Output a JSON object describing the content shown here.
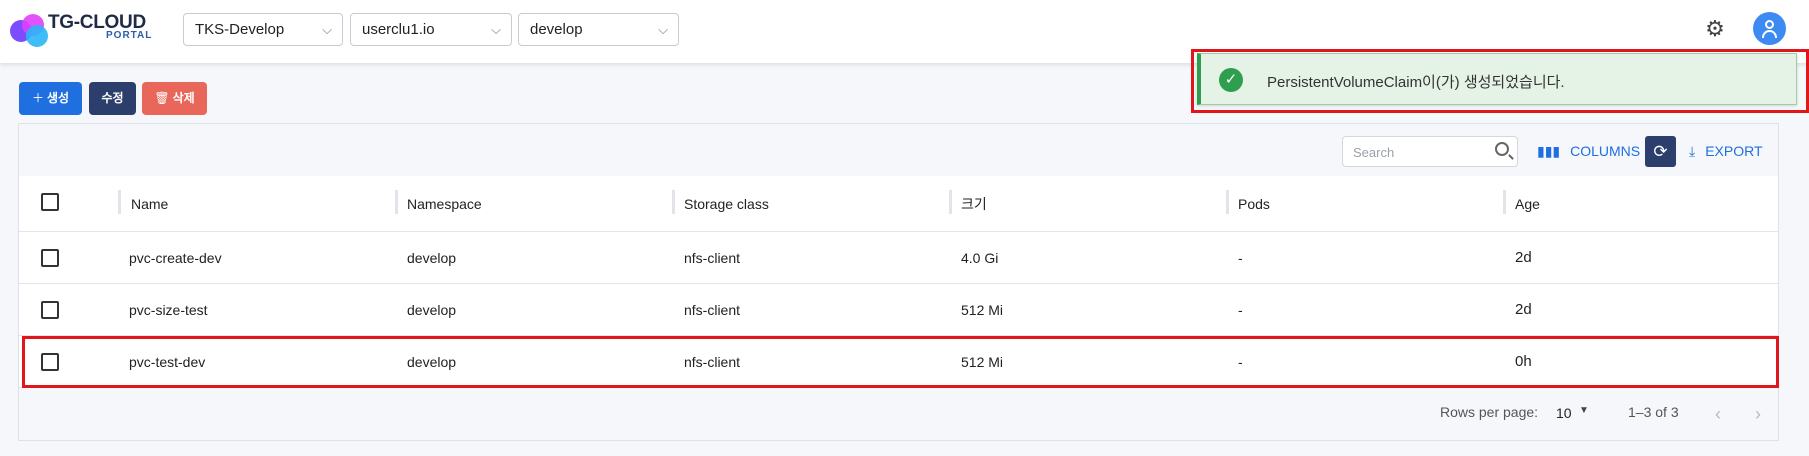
{
  "header": {
    "logo_title": "TG-CLOUD",
    "logo_subtitle": "PORTAL",
    "cluster": "TKS-Develop",
    "user_cluster": "userclu1.io",
    "namespace": "develop"
  },
  "toast": {
    "message": "PersistentVolumeClaim이(가) 생성되었습니다.",
    "color": "#2e9e4f"
  },
  "actions": {
    "create": "생성",
    "edit": "수정",
    "delete": "삭제"
  },
  "toolbar": {
    "search_placeholder": "Search",
    "columns": "COLUMNS",
    "export": "EXPORT"
  },
  "table": {
    "columns": [
      "Name",
      "Namespace",
      "Storage class",
      "크기",
      "Pods",
      "Age"
    ],
    "rows": [
      {
        "name": "pvc-create-dev",
        "namespace": "develop",
        "storage_class": "nfs-client",
        "size": "4.0 Gi",
        "pods": "-",
        "age": "2d"
      },
      {
        "name": "pvc-size-test",
        "namespace": "develop",
        "storage_class": "nfs-client",
        "size": "512 Mi",
        "pods": "-",
        "age": "2d"
      },
      {
        "name": "pvc-test-dev",
        "namespace": "develop",
        "storage_class": "nfs-client",
        "size": "512 Mi",
        "pods": "-",
        "age": "0h"
      }
    ]
  },
  "pagination": {
    "rows_per_page_label": "Rows per page:",
    "rows_per_page": "10",
    "range": "1–3 of 3"
  },
  "colors": {
    "primary": "#1f6fe0",
    "dark": "#2c3f6c",
    "danger": "#e8675a",
    "highlight": "#e0161b"
  }
}
